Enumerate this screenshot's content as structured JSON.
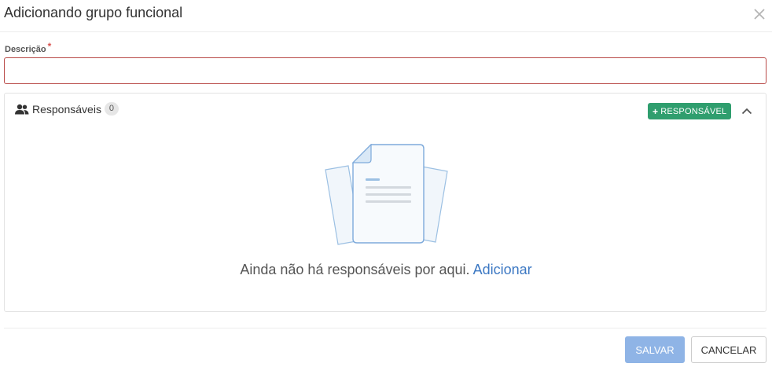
{
  "dialog": {
    "title": "Adicionando grupo funcional"
  },
  "form": {
    "description_label": "Descrição",
    "required_marker": "*",
    "description_value": ""
  },
  "responsaveis": {
    "title": "Responsáveis",
    "count": "0",
    "add_button_plus": "+",
    "add_button_label": "RESPONSÁVEL",
    "empty_message": "Ainda não há responsáveis por aqui.",
    "empty_link": "Adicionar"
  },
  "footer": {
    "save_label": "SALVAR",
    "cancel_label": "CANCELAR"
  },
  "icons": {
    "close": "close-icon",
    "users": "users-icon",
    "collapse": "chevron-up-icon",
    "empty": "documents-illustration"
  },
  "colors": {
    "add_button": "#2f9e6e",
    "save_button": "#8fb4e6",
    "link": "#3c78c3",
    "error_border": "#b94a48",
    "required": "#d9534f"
  }
}
